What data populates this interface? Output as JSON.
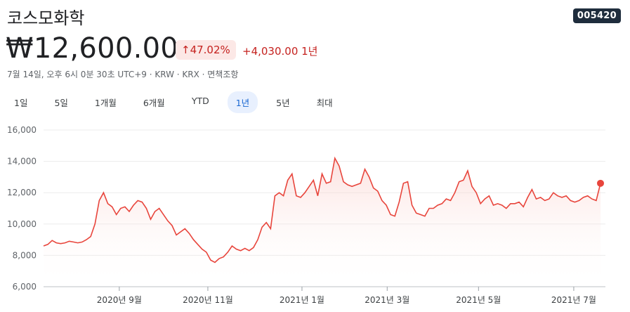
{
  "header": {
    "title": "코스모화학",
    "ticker": "005420",
    "price": "₩12,600.00",
    "pct_change": "↑47.02%",
    "abs_change": "+4,030.00 1년",
    "meta": "7월 14일, 오후 6시 0분 30초 UTC+9 · KRW · KRX · 면책조항"
  },
  "tabs": [
    {
      "label": "1일",
      "active": false
    },
    {
      "label": "5일",
      "active": false
    },
    {
      "label": "1개월",
      "active": false
    },
    {
      "label": "6개월",
      "active": false
    },
    {
      "label": "YTD",
      "active": false
    },
    {
      "label": "1년",
      "active": true
    },
    {
      "label": "5년",
      "active": false
    },
    {
      "label": "최대",
      "active": false
    }
  ],
  "colors": {
    "line": "#e8453c",
    "fill_top": "#f9c9c4",
    "accent": "#c5221f"
  },
  "chart_data": {
    "type": "area",
    "ylim": [
      6000,
      16000
    ],
    "yticks": [
      "16,000",
      "14,000",
      "12,000",
      "10,000",
      "8,000",
      "6,000"
    ],
    "ytick_values": [
      16000,
      14000,
      12000,
      10000,
      8000,
      6000
    ],
    "xticks": [
      {
        "label": "2020년 9월",
        "t": 0.136
      },
      {
        "label": "2020년 11월",
        "t": 0.295
      },
      {
        "label": "2021년 1월",
        "t": 0.464
      },
      {
        "label": "2021년 3월",
        "t": 0.617
      },
      {
        "label": "2021년 5월",
        "t": 0.781
      },
      {
        "label": "2021년 7월",
        "t": 0.952
      }
    ],
    "series": [
      {
        "values": [
          8600,
          8700,
          8950,
          8800,
          8750,
          8800,
          8900,
          8850,
          8800,
          8850,
          9000,
          9200,
          10000,
          11500,
          12000,
          11300,
          11100,
          10600,
          11000,
          11100,
          10800,
          11200,
          11500,
          11400,
          11000,
          10300,
          10800,
          11000,
          10600,
          10200,
          9900,
          9300,
          9500,
          9700,
          9400,
          9000,
          8700,
          8400,
          8200,
          7700,
          7550,
          7800,
          7900,
          8200,
          8600,
          8400,
          8300,
          8450,
          8300,
          8500,
          9000,
          9800,
          10100,
          9700,
          11800,
          12000,
          11800,
          12800,
          13200,
          11800,
          11700,
          12000,
          12400,
          12800,
          11800,
          13200,
          12600,
          12700,
          14200,
          13700,
          12700,
          12500,
          12400,
          12500,
          12600,
          13500,
          13000,
          12300,
          12100,
          11500,
          11200,
          10600,
          10500,
          11400,
          12600,
          12700,
          11200,
          10700,
          10600,
          10500,
          11000,
          11000,
          11200,
          11300,
          11600,
          11500,
          12000,
          12700,
          12800,
          13400,
          12400,
          12000,
          11300,
          11600,
          11800,
          11200,
          11300,
          11200,
          11000,
          11300,
          11300,
          11400,
          11100,
          11700,
          12200,
          11600,
          11700,
          11500,
          11600,
          12000,
          11800,
          11700,
          11800,
          11500,
          11400,
          11500,
          11700,
          11800,
          11600,
          11500,
          12600
        ]
      }
    ]
  }
}
